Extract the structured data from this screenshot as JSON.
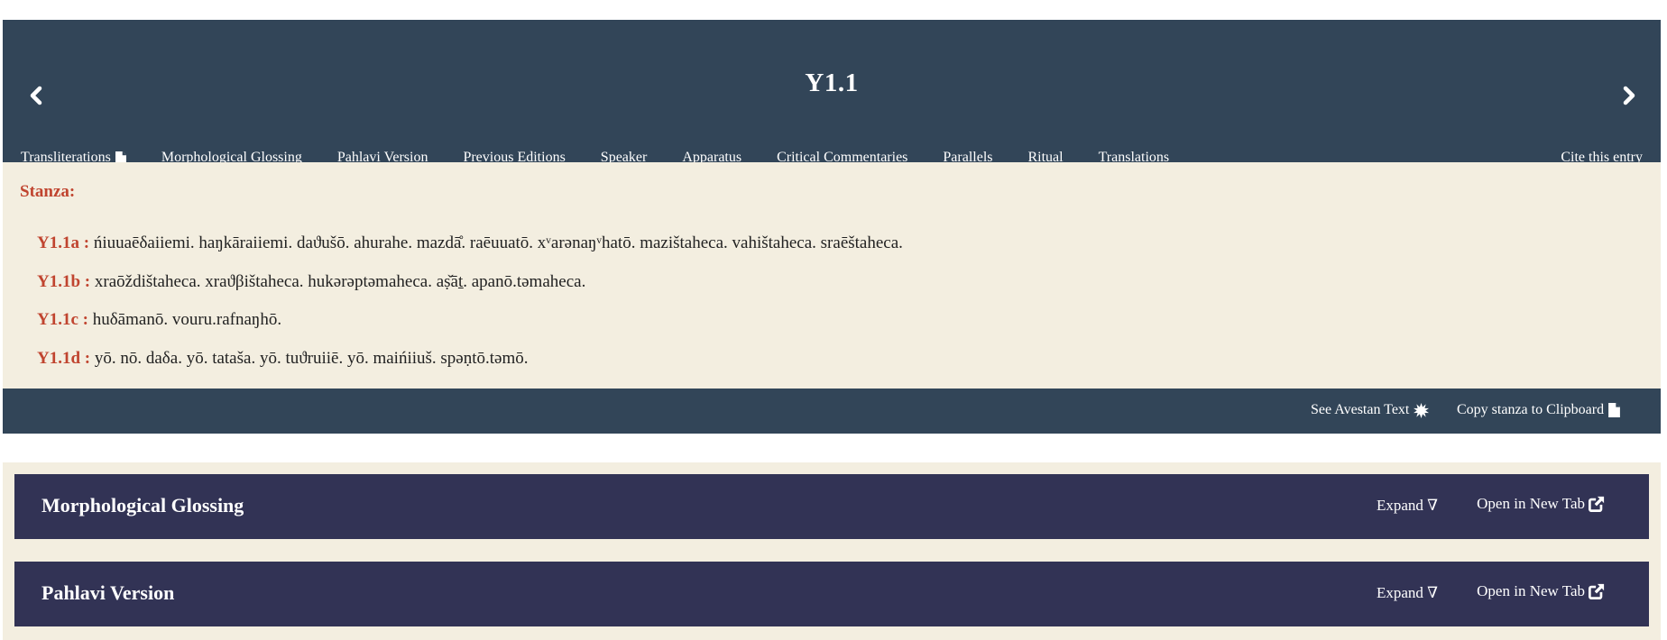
{
  "header": {
    "title": "Y1.1",
    "tabs": [
      {
        "label": "Transliterations"
      },
      {
        "label": "Morphological Glossing"
      },
      {
        "label": "Pahlavi Version"
      },
      {
        "label": "Previous Editions"
      },
      {
        "label": "Speaker"
      },
      {
        "label": "Apparatus"
      },
      {
        "label": "Critical Commentaries"
      },
      {
        "label": "Parallels"
      },
      {
        "label": "Ritual"
      },
      {
        "label": "Translations"
      }
    ],
    "cite_label": "Cite this entry"
  },
  "stanza": {
    "label": "Stanza:",
    "lines": [
      {
        "id": "Y1.1a :",
        "text": "ńiuuaēδaiiemi. haŋkāraiiemi. daϑušō. ahurahe. mazdā̊. raēuuatō. xᵛarənaŋᵛhatō. mazištaheca. vahištaheca. sraēštaheca."
      },
      {
        "id": "Y1.1b :",
        "text": "xraōždištaheca. xraϑβištaheca. hukərəptəmaheca. aṣ̌āṯ. apanō.təmaheca."
      },
      {
        "id": "Y1.1c :",
        "text": "huδāmanō. vouru.rafnaŋhō."
      },
      {
        "id": "Y1.1d :",
        "text": "yō. nō. daδa. yō. tataša. yō. tuϑruiiē. yō. maińiiuš. spəṇtō.təmō."
      }
    ],
    "see_avestan_label": "See Avestan Text",
    "copy_label": "Copy stanza to Clipboard"
  },
  "sections": [
    {
      "title": "Morphological Glossing",
      "expand_label": "Expand ∇",
      "open_label": "Open in New Tab"
    },
    {
      "title": "Pahlavi Version",
      "expand_label": "Expand ∇",
      "open_label": "Open in New Tab"
    }
  ],
  "colors": {
    "header_bg": "#324558",
    "stanza_bg": "#f3eee0",
    "accent_red": "#c0442f",
    "panel_bg": "#323355"
  }
}
